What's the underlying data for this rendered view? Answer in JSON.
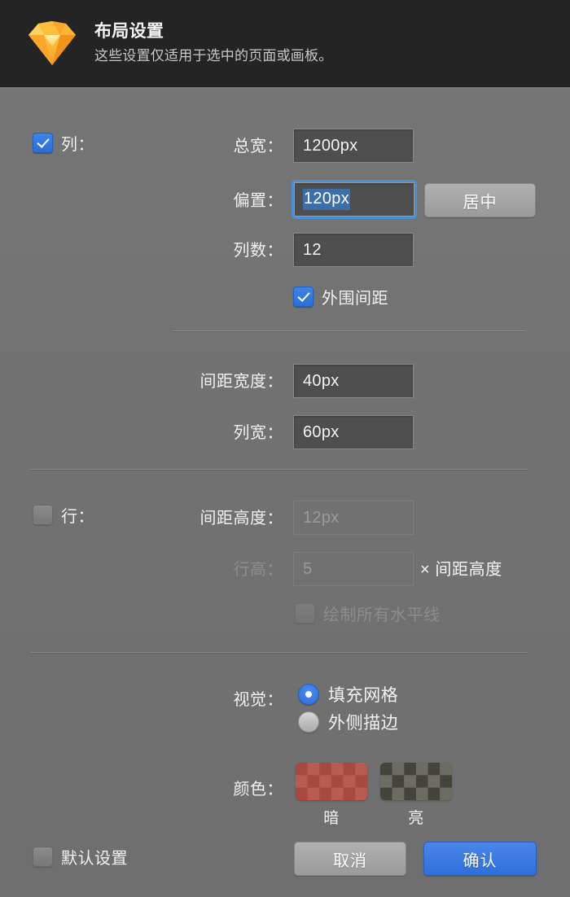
{
  "header": {
    "icon": "sketch-diamond-logo",
    "title": "布局设置",
    "subtitle": "这些设置仅适用于选中的页面或画板。"
  },
  "columns": {
    "enabled_label": "列：",
    "enabled_checked": true,
    "total_width": {
      "label": "总宽：",
      "value": "1200px"
    },
    "offset": {
      "label": "偏置：",
      "value": "120px",
      "focused": true,
      "selected": true
    },
    "center_button": "居中",
    "count": {
      "label": "列数：",
      "value": "12"
    },
    "outer_gutter": {
      "label": "外围间距",
      "checked": true
    },
    "gutter_width": {
      "label": "间距宽度：",
      "value": "40px"
    },
    "column_width": {
      "label": "列宽：",
      "value": "60px"
    }
  },
  "rows": {
    "enabled_label": "行：",
    "enabled_checked": false,
    "disabled": true,
    "gutter_height": {
      "label": "间距高度：",
      "value": "12px"
    },
    "row_height": {
      "label": "行高：",
      "value": "5",
      "multiplier_suffix": "× 间距高度"
    },
    "draw_all_horizontal": {
      "label": "绘制所有水平线",
      "checked": false
    }
  },
  "visual": {
    "label": "视觉：",
    "options": [
      {
        "label": "填充网格",
        "selected": true
      },
      {
        "label": "外侧描边",
        "selected": false
      }
    ]
  },
  "color": {
    "label": "颜色：",
    "swatches": [
      {
        "caption": "暗",
        "color_a": "#a84840",
        "color_b": "#b85c52"
      },
      {
        "caption": "亮",
        "color_a": "#44443a",
        "color_b": "#6c6c61"
      }
    ]
  },
  "footer": {
    "defaults": {
      "label": "默认设置",
      "checked": false
    },
    "cancel": "取消",
    "confirm": "确认"
  },
  "theme": {
    "header_bg": "#242424",
    "panel_bg": "#727272",
    "accent_blue": "#2f6fdb",
    "field_bg": "#4e4e4e"
  }
}
